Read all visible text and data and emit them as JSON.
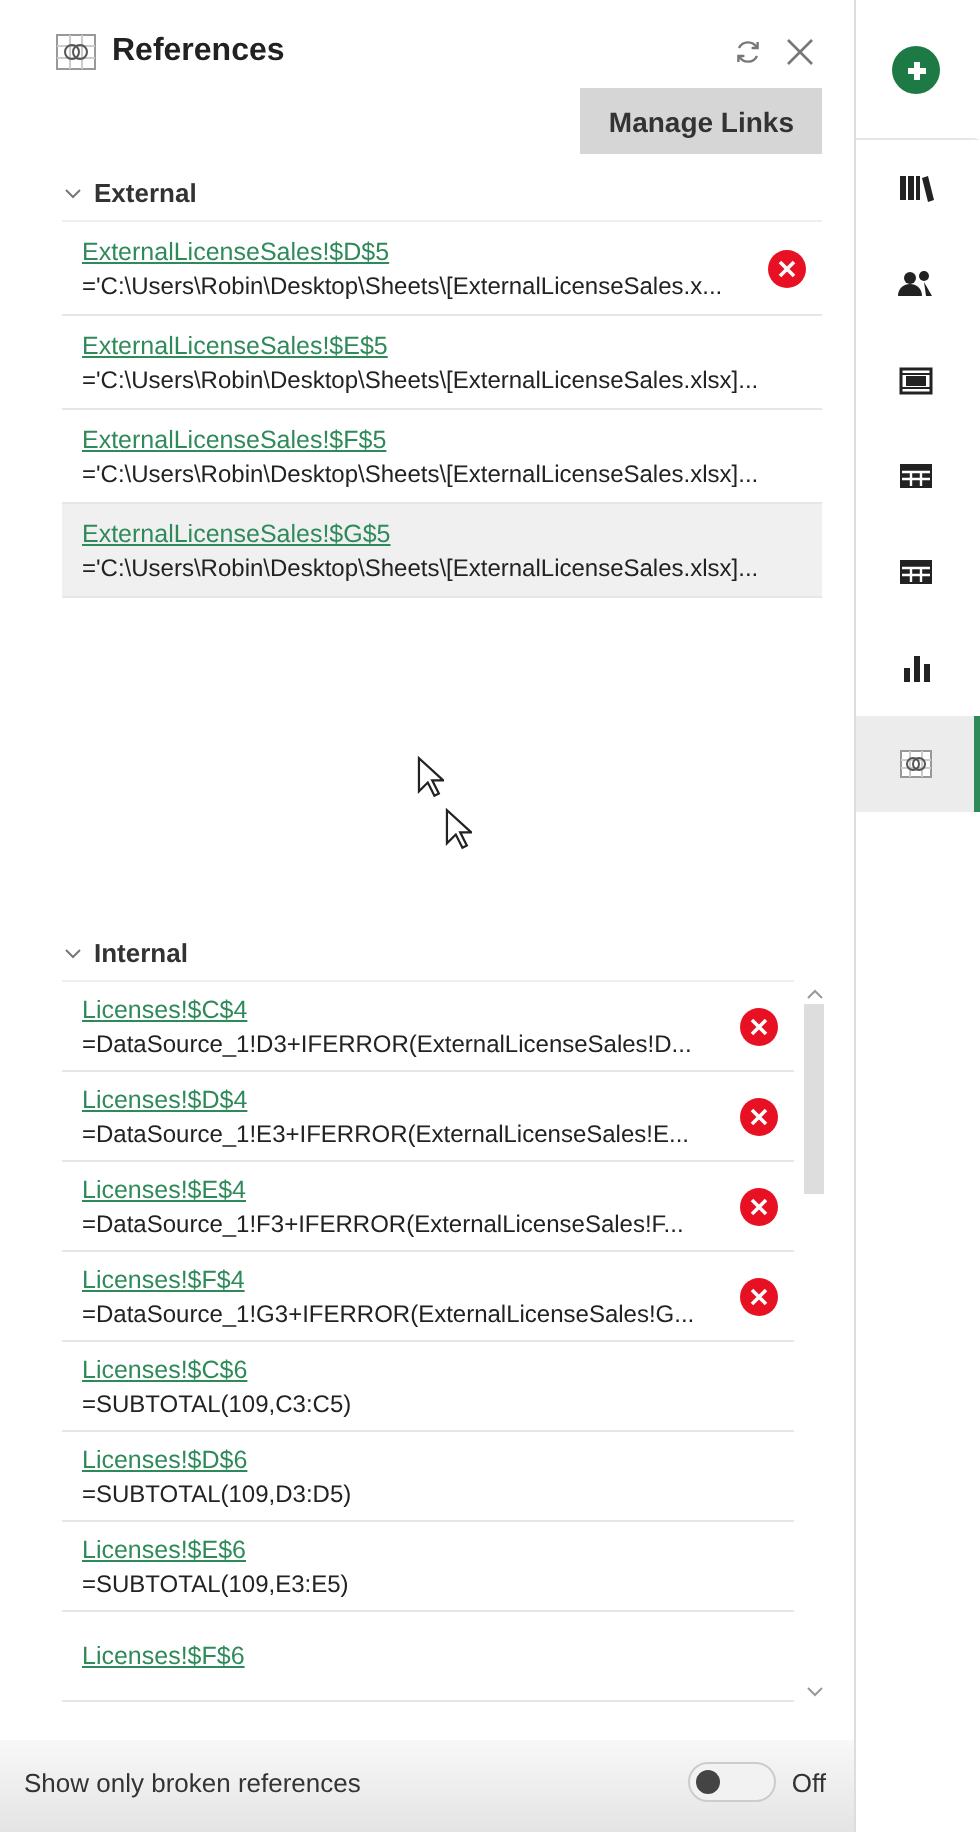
{
  "panel": {
    "title": "References",
    "manage_button": "Manage Links"
  },
  "sections": [
    {
      "label": "External",
      "expanded": true,
      "scrollable": false,
      "rows": [
        {
          "reference": "ExternalLicenseSales!$D$5",
          "formula": "='C:\\Users\\Robin\\Desktop\\Sheets\\[ExternalLicenseSales.x...",
          "broken": true,
          "selected": false
        },
        {
          "reference": "ExternalLicenseSales!$E$5",
          "formula": "='C:\\Users\\Robin\\Desktop\\Sheets\\[ExternalLicenseSales.xlsx]...",
          "broken": false,
          "selected": false
        },
        {
          "reference": "ExternalLicenseSales!$F$5",
          "formula": "='C:\\Users\\Robin\\Desktop\\Sheets\\[ExternalLicenseSales.xlsx]...",
          "broken": false,
          "selected": false
        },
        {
          "reference": "ExternalLicenseSales!$G$5",
          "formula": "='C:\\Users\\Robin\\Desktop\\Sheets\\[ExternalLicenseSales.xlsx]...",
          "broken": false,
          "selected": true
        }
      ]
    },
    {
      "label": "Internal",
      "expanded": true,
      "scrollable": true,
      "rows": [
        {
          "reference": "Licenses!$C$4",
          "formula": "=DataSource_1!D3+IFERROR(ExternalLicenseSales!D...",
          "broken": true,
          "selected": false
        },
        {
          "reference": "Licenses!$D$4",
          "formula": "=DataSource_1!E3+IFERROR(ExternalLicenseSales!E...",
          "broken": true,
          "selected": false
        },
        {
          "reference": "Licenses!$E$4",
          "formula": "=DataSource_1!F3+IFERROR(ExternalLicenseSales!F...",
          "broken": true,
          "selected": false
        },
        {
          "reference": "Licenses!$F$4",
          "formula": "=DataSource_1!G3+IFERROR(ExternalLicenseSales!G...",
          "broken": true,
          "selected": false
        },
        {
          "reference": "Licenses!$C$6",
          "formula": "=SUBTOTAL(109,C3:C5)",
          "broken": false,
          "selected": false
        },
        {
          "reference": "Licenses!$D$6",
          "formula": "=SUBTOTAL(109,D3:D5)",
          "broken": false,
          "selected": false
        },
        {
          "reference": "Licenses!$E$6",
          "formula": "=SUBTOTAL(109,E3:E5)",
          "broken": false,
          "selected": false
        },
        {
          "reference": "Licenses!$F$6",
          "broken": false,
          "selected": false
        }
      ]
    }
  ],
  "footer": {
    "label": "Show only broken references",
    "toggle": {
      "on": false,
      "state_label": "Off"
    }
  },
  "rail": [
    {
      "kind": "logo",
      "selected": false
    },
    {
      "kind": "books",
      "selected": false
    },
    {
      "kind": "people",
      "selected": false
    },
    {
      "kind": "film",
      "selected": false
    },
    {
      "kind": "table",
      "selected": false
    },
    {
      "kind": "table",
      "selected": false
    },
    {
      "kind": "chart",
      "selected": false
    },
    {
      "kind": "references",
      "selected": true
    }
  ]
}
